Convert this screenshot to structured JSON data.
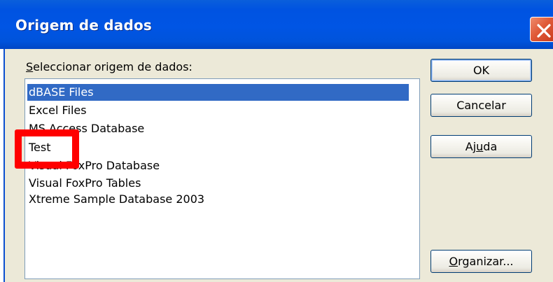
{
  "window": {
    "title": "Origem de dados",
    "close_icon": "close-icon"
  },
  "list": {
    "label_accel": "S",
    "label_rest": "eleccionar origem de dados:",
    "items": [
      {
        "label": "dBASE Files",
        "selected": true
      },
      {
        "label": "Excel Files",
        "selected": false
      },
      {
        "label": "MS Access Database",
        "selected": false
      },
      {
        "label": "Test",
        "selected": false
      },
      {
        "label": "Visual FoxPro Database",
        "selected": false
      },
      {
        "label": "Visual FoxPro Tables",
        "selected": false
      },
      {
        "label": "Xtreme Sample Database 2003",
        "selected": false
      }
    ]
  },
  "buttons": {
    "ok": "OK",
    "cancel": "Cancelar",
    "help_pre": "Aj",
    "help_accel": "u",
    "help_post": "da",
    "organize_accel": "O",
    "organize_rest": "rganizar..."
  },
  "colors": {
    "titlebar": "#0055e4",
    "selection": "#316ac5",
    "dialog_bg": "#ece9d8",
    "close_button": "#e05a38",
    "highlight": "#ff0000"
  }
}
